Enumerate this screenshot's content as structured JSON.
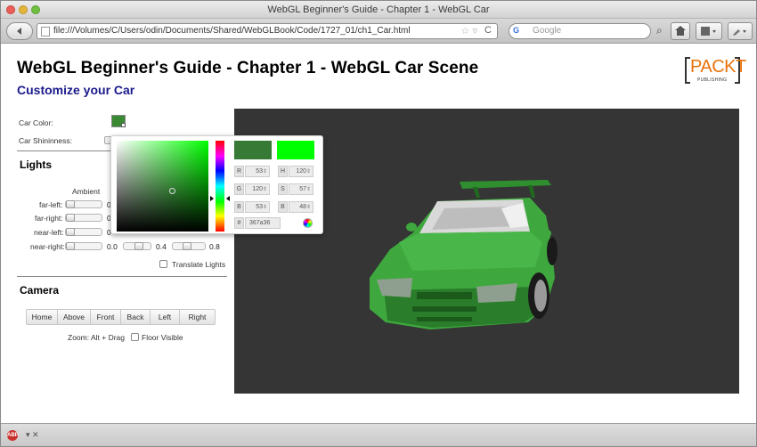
{
  "window": {
    "title": "WebGL Beginner's Guide - Chapter 1 - WebGL Car"
  },
  "toolbar": {
    "back_icon": "back-arrow-icon",
    "url": "file:///Volumes/C/Users/odin/Documents/Shared/WebGLBook/Code/1727_01/ch1_Car.html",
    "search_placeholder": "Google",
    "search_engine_label": "G"
  },
  "page": {
    "title": "WebGL Beginner's Guide - Chapter 1 - WebGL Car Scene",
    "subtitle": "Customize your Car",
    "logo_text": "PACKT",
    "logo_sub": "PUBLISHING"
  },
  "controls": {
    "car_color_label": "Car Color:",
    "car_shininess_label": "Car Shininness:",
    "car_color": "#3a8a34"
  },
  "lights": {
    "title": "Lights",
    "ambient_label": "Ambient",
    "rows": [
      {
        "label": "far-left:",
        "value": "0"
      },
      {
        "label": "far-right:",
        "value": "0"
      },
      {
        "label": "near-left:",
        "value": "0"
      }
    ],
    "near_right": {
      "label": "near-right:",
      "v1": "0.0",
      "v2": "0.4",
      "v3": "0.8"
    },
    "translate_label": "Translate Lights"
  },
  "camera": {
    "title": "Camera",
    "buttons": [
      "Home",
      "Above",
      "Front",
      "Back",
      "Left",
      "Right"
    ],
    "zoom_label": "Zoom: Alt + Drag",
    "floor_label": "Floor Visible"
  },
  "picker": {
    "new_color": "#367a36",
    "current_color": "#00ff00",
    "fields": {
      "R": "53",
      "H": "120",
      "G": "120",
      "S": "57",
      "B": "53",
      "B2": "48"
    },
    "hex": "367a36"
  },
  "scene": {
    "background": "#353535",
    "car_color": "#3da43d"
  }
}
